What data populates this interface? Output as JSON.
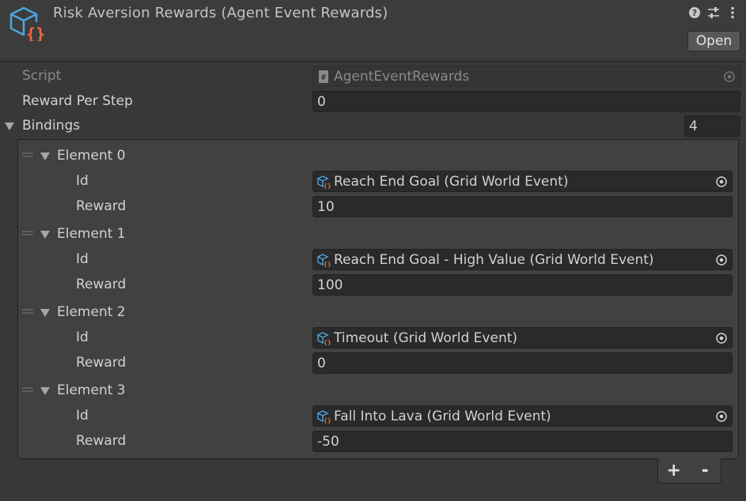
{
  "header": {
    "title": "Risk Aversion Rewards (Agent Event Rewards)",
    "open_label": "Open",
    "icons": [
      "help-icon",
      "presets-icon",
      "more-icon"
    ]
  },
  "script": {
    "label": "Script",
    "value": "AgentEventRewards"
  },
  "reward_per_step": {
    "label": "Reward Per Step",
    "value": "0"
  },
  "bindings": {
    "label": "Bindings",
    "size": "4",
    "elements": [
      {
        "label": "Element 0",
        "id_label": "Id",
        "id_value": "Reach End Goal (Grid World Event)",
        "reward_label": "Reward",
        "reward_value": "10"
      },
      {
        "label": "Element 1",
        "id_label": "Id",
        "id_value": "Reach End Goal - High Value (Grid World Event)",
        "reward_label": "Reward",
        "reward_value": "100"
      },
      {
        "label": "Element 2",
        "id_label": "Id",
        "id_value": "Timeout (Grid World Event)",
        "reward_label": "Reward",
        "reward_value": "0"
      },
      {
        "label": "Element 3",
        "id_label": "Id",
        "id_value": "Fall Into Lava (Grid World Event)",
        "reward_label": "Reward",
        "reward_value": "-50"
      }
    ],
    "add_label": "+",
    "remove_label": "-"
  },
  "colors": {
    "panel": "#383838",
    "header": "#3c3c3c",
    "field": "#2a2a2a",
    "icon_cube": "#4fa3e0",
    "icon_braces": "#f26c3a"
  }
}
